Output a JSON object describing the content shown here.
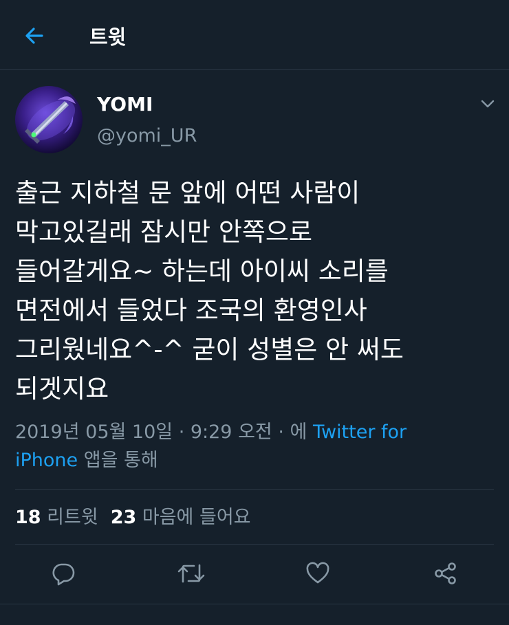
{
  "header": {
    "title": "트윗",
    "back_icon": "arrow-left-icon"
  },
  "tweet": {
    "display_name": "YOMI",
    "username": "@yomi_UR",
    "text_lines": [
      "출근 지하철 문 앞에 어떤 사람이",
      "막고있길래 잠시만 안쪽으로",
      "들어갈게요~ 하는데 아이씨 소리를",
      "면전에서 들었다 조국의 환영인사",
      "그리웠네요^-^ 굳이 성별은 안 써도",
      "되겟지요"
    ],
    "meta": {
      "date_time": "2019년 05월 10일 · 9:29 오전 · 에 ",
      "source_part1": "Twitter for",
      "source_part2": "iPhone",
      "suffix": " 앱을 통해"
    },
    "stats": {
      "retweets_count": "18",
      "retweets_label": "리트윗",
      "likes_count": "23",
      "likes_label": "마음에 들어요"
    }
  },
  "actions": [
    "reply-icon",
    "retweet-icon",
    "like-icon",
    "share-icon"
  ],
  "colors": {
    "background": "#15202b",
    "accent": "#1da1f2",
    "muted": "#8899a6",
    "divider": "#2a3744"
  }
}
